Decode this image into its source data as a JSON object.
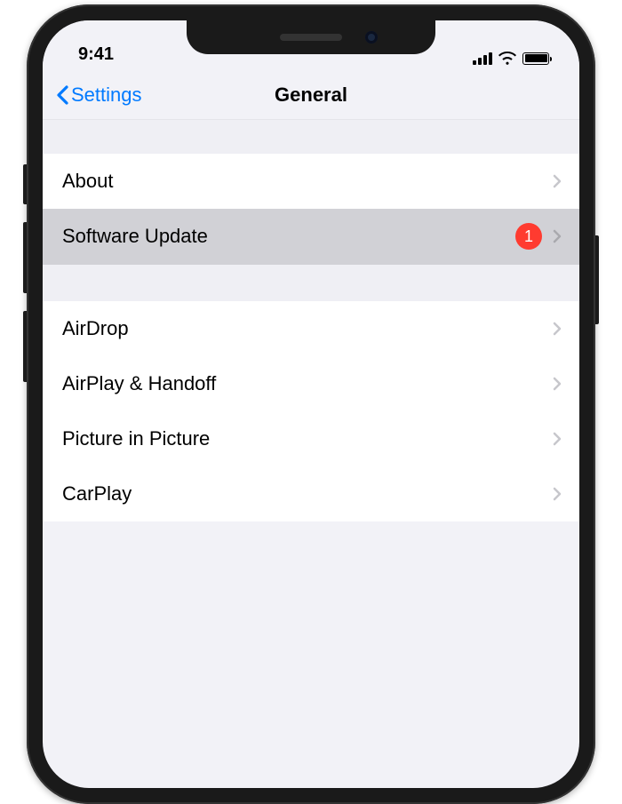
{
  "status": {
    "time": "9:41"
  },
  "nav": {
    "back_label": "Settings",
    "title": "General"
  },
  "sections": [
    {
      "rows": [
        {
          "label": "About",
          "badge": null,
          "selected": false
        },
        {
          "label": "Software Update",
          "badge": "1",
          "selected": true
        }
      ]
    },
    {
      "rows": [
        {
          "label": "AirDrop",
          "badge": null,
          "selected": false
        },
        {
          "label": "AirPlay & Handoff",
          "badge": null,
          "selected": false
        },
        {
          "label": "Picture in Picture",
          "badge": null,
          "selected": false
        },
        {
          "label": "CarPlay",
          "badge": null,
          "selected": false
        }
      ]
    }
  ]
}
